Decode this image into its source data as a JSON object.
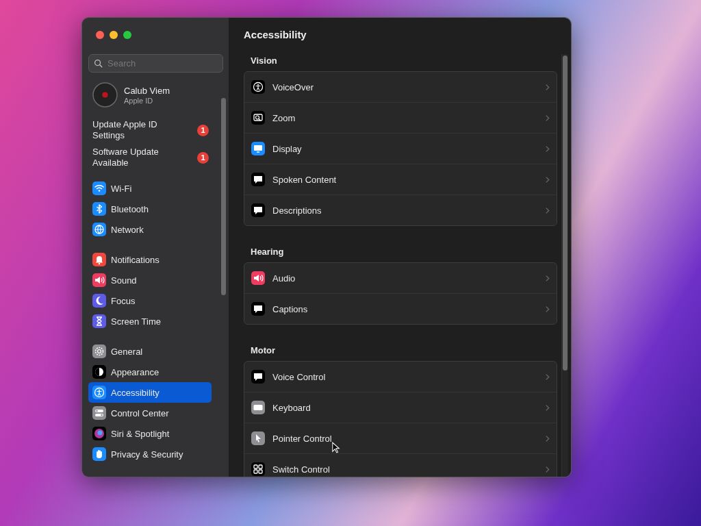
{
  "window": {
    "title": "Accessibility"
  },
  "sidebar": {
    "search": {
      "placeholder": "Search"
    },
    "account": {
      "name": "Calub Viem",
      "subtitle": "Apple ID"
    },
    "notices": [
      {
        "label": "Update Apple ID Settings",
        "badge": "1"
      },
      {
        "label": "Software Update Available",
        "badge": "1"
      }
    ],
    "groups": [
      [
        {
          "label": "Wi-Fi",
          "selected": false
        },
        {
          "label": "Bluetooth",
          "selected": false
        },
        {
          "label": "Network",
          "selected": false
        }
      ],
      [
        {
          "label": "Notifications",
          "selected": false
        },
        {
          "label": "Sound",
          "selected": false
        },
        {
          "label": "Focus",
          "selected": false
        },
        {
          "label": "Screen Time",
          "selected": false
        }
      ],
      [
        {
          "label": "General",
          "selected": false
        },
        {
          "label": "Appearance",
          "selected": false
        },
        {
          "label": "Accessibility",
          "selected": true
        },
        {
          "label": "Control Center",
          "selected": false
        },
        {
          "label": "Siri & Spotlight",
          "selected": false
        },
        {
          "label": "Privacy & Security",
          "selected": false
        }
      ]
    ]
  },
  "sections": [
    {
      "title": "Vision",
      "items": [
        {
          "label": "VoiceOver"
        },
        {
          "label": "Zoom"
        },
        {
          "label": "Display"
        },
        {
          "label": "Spoken Content"
        },
        {
          "label": "Descriptions"
        }
      ]
    },
    {
      "title": "Hearing",
      "items": [
        {
          "label": "Audio"
        },
        {
          "label": "Captions"
        }
      ]
    },
    {
      "title": "Motor",
      "items": [
        {
          "label": "Voice Control"
        },
        {
          "label": "Keyboard"
        },
        {
          "label": "Pointer Control"
        },
        {
          "label": "Switch Control"
        }
      ]
    }
  ]
}
